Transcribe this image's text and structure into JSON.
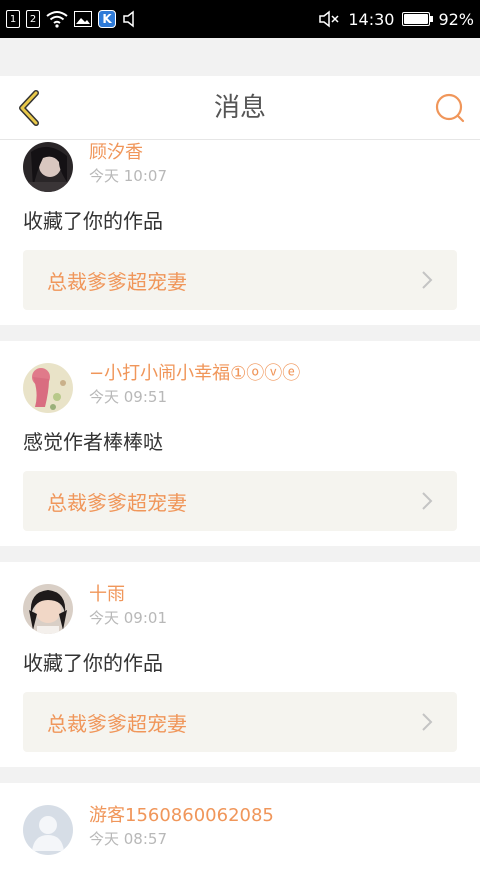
{
  "status_bar": {
    "sim1": "1",
    "sim2": "2",
    "app_badge": "K",
    "time": "14:30",
    "battery": "92%"
  },
  "header": {
    "title": "消息"
  },
  "messages": [
    {
      "username": "顾汐香",
      "time": "今天 10:07",
      "text": "收藏了你的作品",
      "work_title": "总裁爹爹超宠妻"
    },
    {
      "username": "−小打小闹小幸福①ⓞⓥⓔ",
      "time": "今天 09:51",
      "text": "感觉作者棒棒哒",
      "work_title": "总裁爹爹超宠妻"
    },
    {
      "username": "十雨",
      "time": "今天 09:01",
      "text": "收藏了你的作品",
      "work_title": "总裁爹爹超宠妻"
    },
    {
      "username": "游客1560860062085",
      "time": "今天 08:57"
    }
  ],
  "colors": {
    "accent": "#f0965a",
    "back_icon": "#e8c84a",
    "background": "#f2f2f2",
    "card": "#ffffff",
    "work_bg": "#f5f4ef"
  }
}
